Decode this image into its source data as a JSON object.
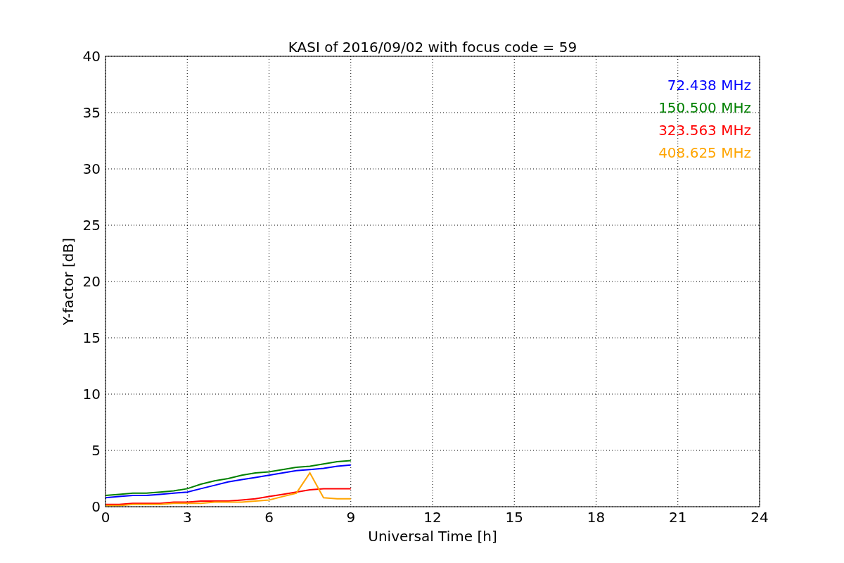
{
  "chart_data": {
    "type": "line",
    "title": "KASI of 2016/09/02 with focus code = 59",
    "xlabel": "Universal Time [h]",
    "ylabel": "Y-factor [dB]",
    "x": [
      0,
      0.5,
      1,
      1.5,
      2,
      2.5,
      3,
      3.5,
      4,
      4.5,
      5,
      5.5,
      6,
      6.5,
      7,
      7.5,
      8,
      8.5,
      9
    ],
    "series": [
      {
        "name": "72.438 MHz",
        "color": "#0000ff",
        "values": [
          0.8,
          0.9,
          1.0,
          1.0,
          1.1,
          1.2,
          1.3,
          1.6,
          1.9,
          2.2,
          2.4,
          2.6,
          2.8,
          3.0,
          3.2,
          3.3,
          3.4,
          3.6,
          3.7
        ]
      },
      {
        "name": "150.500 MHz",
        "color": "#008000",
        "values": [
          1.0,
          1.1,
          1.2,
          1.2,
          1.3,
          1.4,
          1.6,
          2.0,
          2.3,
          2.5,
          2.8,
          3.0,
          3.1,
          3.3,
          3.5,
          3.6,
          3.8,
          4.0,
          4.1
        ]
      },
      {
        "name": "323.563 MHz",
        "color": "#ff0000",
        "values": [
          0.2,
          0.2,
          0.3,
          0.3,
          0.3,
          0.4,
          0.4,
          0.5,
          0.5,
          0.5,
          0.6,
          0.7,
          0.9,
          1.1,
          1.3,
          1.5,
          1.6,
          1.6,
          1.6
        ]
      },
      {
        "name": "408.625 MHz",
        "color": "#ffa500",
        "values": [
          0.1,
          0.1,
          0.2,
          0.2,
          0.2,
          0.3,
          0.3,
          0.3,
          0.4,
          0.4,
          0.4,
          0.5,
          0.6,
          0.9,
          1.2,
          3.0,
          0.8,
          0.7,
          0.7
        ]
      }
    ],
    "xlim": [
      0,
      24
    ],
    "ylim": [
      0,
      40
    ],
    "xticks": [
      0,
      3,
      6,
      9,
      12,
      15,
      18,
      21,
      24
    ],
    "yticks": [
      0,
      5,
      10,
      15,
      20,
      25,
      30,
      35,
      40
    ],
    "grid": true
  }
}
